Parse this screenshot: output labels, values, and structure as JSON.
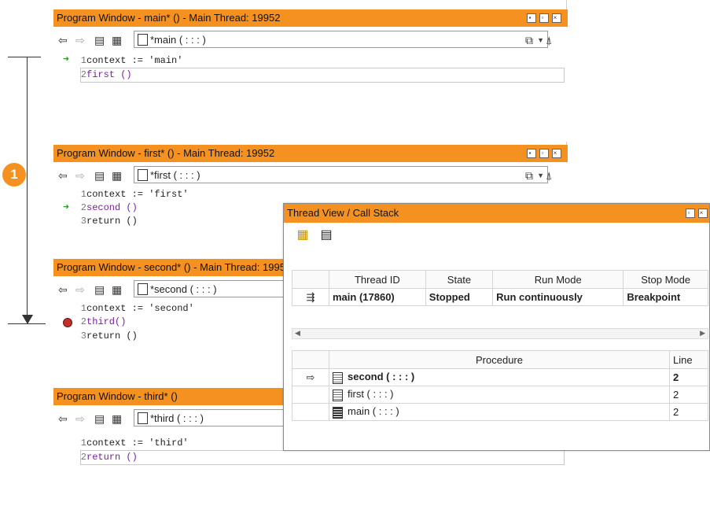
{
  "annotation": {
    "step_number": "1"
  },
  "windows": [
    {
      "title": "Program Window - main* () - Main Thread: 19952",
      "combo_value": "*main ( : : : )",
      "lines": [
        {
          "num": "1",
          "text": "context := 'main'"
        },
        {
          "num": "2",
          "text": "first ()"
        }
      ]
    },
    {
      "title": "Program Window - first* () - Main Thread: 19952",
      "combo_value": "*first ( : : : )",
      "lines": [
        {
          "num": "1",
          "text": "context := 'first'"
        },
        {
          "num": "2",
          "text": "second ()"
        },
        {
          "num": "3",
          "text": "return ()"
        }
      ]
    },
    {
      "title": "Program Window - second* () - Main Thread: 19952",
      "combo_value": "*second ( : : : )",
      "lines": [
        {
          "num": "1",
          "text": "context := 'second'"
        },
        {
          "num": "2",
          "text": "third()"
        },
        {
          "num": "3",
          "text": "return ()"
        }
      ]
    },
    {
      "title": "Program Window - third* ()",
      "combo_value": "*third ( : : : )",
      "lines": [
        {
          "num": "1",
          "text": "context := 'third'"
        },
        {
          "num": "2",
          "text": "return ()"
        }
      ]
    }
  ],
  "thread_view": {
    "title": "Thread View / Call Stack",
    "thread_columns": [
      "Thread ID",
      "State",
      "Run Mode",
      "Stop Mode"
    ],
    "thread_row": {
      "id": "main (17860)",
      "state": "Stopped",
      "run_mode": "Run continuously",
      "stop_mode": "Breakpoint"
    },
    "stack_columns": [
      "Procedure",
      "Line"
    ],
    "stack_rows": [
      {
        "procedure": "second ( : : : )",
        "line": "2"
      },
      {
        "procedure": "first ( : : : )",
        "line": "2"
      },
      {
        "procedure": "main ( : : : )",
        "line": "2"
      }
    ]
  },
  "icons": {
    "back": "back-arrow-icon",
    "forward": "forward-arrow-icon",
    "clipboard": "clipboard-icon",
    "grid": "grid-icon",
    "program": "program-icon",
    "copy": "copy-icon",
    "clear": "clear-breakpoints-icon",
    "restore": "restore-icon",
    "close": "close-icon",
    "current-line": "current-line-arrow-icon",
    "breakpoint": "breakpoint-icon"
  },
  "colors": {
    "titlebar": "#f59120",
    "keyword": "#7a1fa2",
    "paren": "#1d8a1d",
    "breakpoint": "#c0302a"
  }
}
